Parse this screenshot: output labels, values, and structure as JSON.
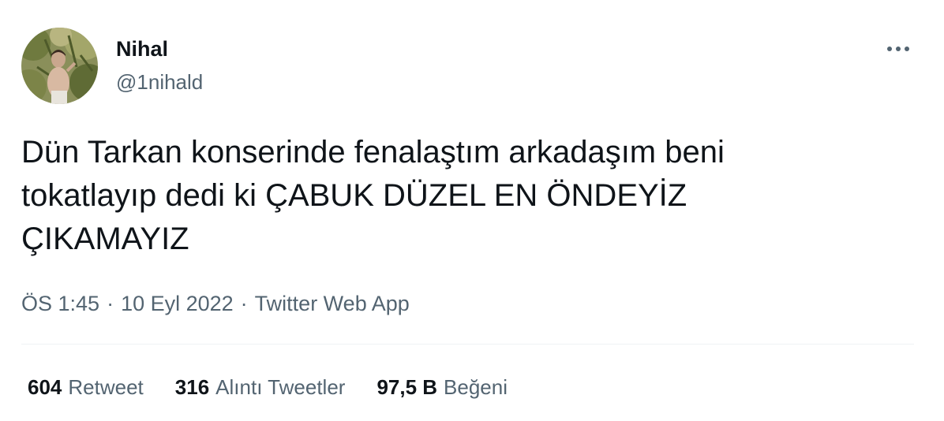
{
  "author": {
    "name": "Nihal",
    "handle": "@1nihald"
  },
  "more_icon": "more-horizontal-icon",
  "tweet": {
    "text": "Dün Tarkan konserinde fenalaştım arkadaşım beni\ntokatlayıp dedi ki ÇABUK DÜZEL EN ÖNDEYİZ\nÇIKAMAYIZ",
    "time": "ÖS 1:45",
    "date": "10 Eyl 2022",
    "source": "Twitter Web App",
    "separator": "·"
  },
  "stats": {
    "retweets": {
      "count": "604",
      "label": "Retweet"
    },
    "quotes": {
      "count": "316",
      "label": "Alıntı Tweetler"
    },
    "likes": {
      "count": "97,5 B",
      "label": "Beğeni"
    }
  },
  "colors": {
    "text_primary": "#0f1419",
    "text_secondary": "#536471",
    "divider": "#eff3f4"
  }
}
